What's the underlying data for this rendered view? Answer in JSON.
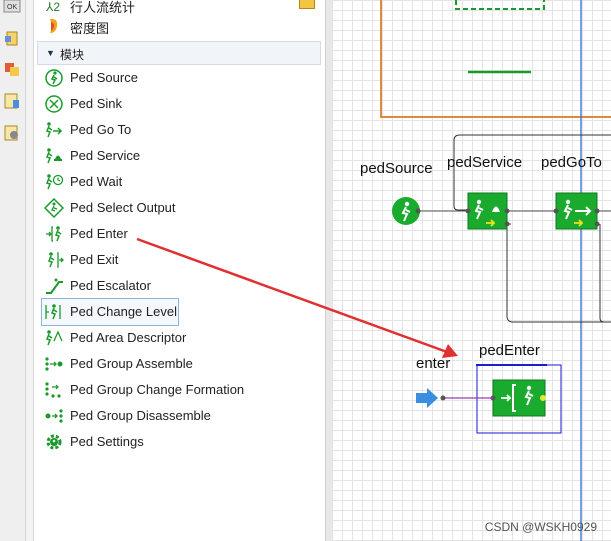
{
  "palette": {
    "top_items": [
      {
        "label": "行人流统计",
        "icon": "stats-icon"
      },
      {
        "label": "密度图",
        "icon": "density-map-icon"
      }
    ],
    "section_label": "模块",
    "items": [
      {
        "label": "Ped Source",
        "icon": "ped-source-icon"
      },
      {
        "label": "Ped Sink",
        "icon": "ped-sink-icon"
      },
      {
        "label": "Ped Go To",
        "icon": "ped-goto-icon"
      },
      {
        "label": "Ped Service",
        "icon": "ped-service-icon"
      },
      {
        "label": "Ped Wait",
        "icon": "ped-wait-icon"
      },
      {
        "label": "Ped Select Output",
        "icon": "ped-select-output-icon"
      },
      {
        "label": "Ped Enter",
        "icon": "ped-enter-icon"
      },
      {
        "label": "Ped Exit",
        "icon": "ped-exit-icon"
      },
      {
        "label": "Ped Escalator",
        "icon": "ped-escalator-icon"
      },
      {
        "label": "Ped Change Level",
        "icon": "ped-change-level-icon"
      },
      {
        "label": "Ped Area Descriptor",
        "icon": "ped-area-descriptor-icon"
      },
      {
        "label": "Ped Group Assemble",
        "icon": "ped-group-assemble-icon"
      },
      {
        "label": "Ped Group Change Formation",
        "icon": "ped-group-change-formation-icon"
      },
      {
        "label": "Ped Group Disassemble",
        "icon": "ped-group-disassemble-icon"
      },
      {
        "label": "Ped Settings",
        "icon": "ped-settings-icon"
      }
    ],
    "selected_item": "Ped Change Level"
  },
  "canvas": {
    "labels": {
      "ped_source": "pedSource",
      "ped_service": "pedService",
      "ped_goto": "pedGoTo",
      "enter": "enter",
      "ped_enter": "pedEnter"
    }
  },
  "colors": {
    "block_green": "#1aab2e",
    "arrow_red": "#e03030",
    "area_orange": "#e08a3c",
    "guide_blue": "#2a6fd6",
    "frame_blue": "#1a1ad0",
    "entry_arrow": "#3a8ee0"
  },
  "watermark": "CSDN @WSKH0929"
}
